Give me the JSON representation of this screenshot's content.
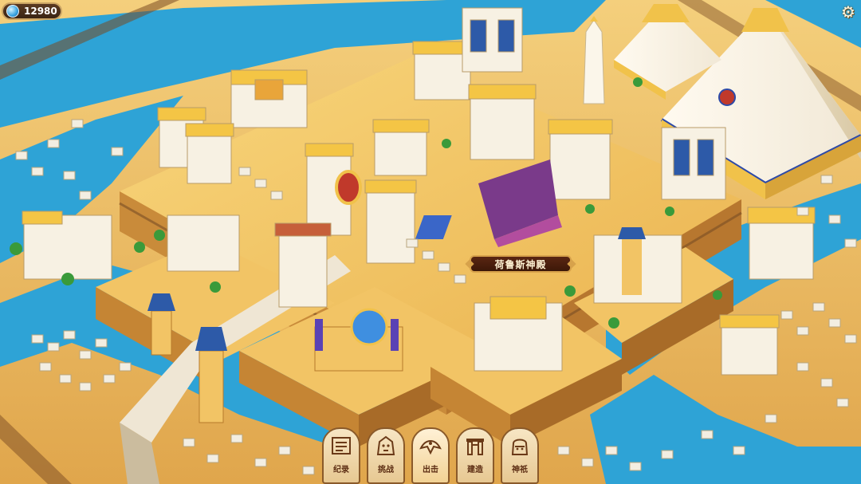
{
  "hud": {
    "gold_amount": "12980",
    "gem_icon": "blue-gem-icon",
    "settings_icon": "gear-icon"
  },
  "map": {
    "temple_label": "荷鲁斯神殿"
  },
  "bottom_menu": {
    "items": [
      {
        "label": "纪录",
        "icon": "scroll-icon"
      },
      {
        "label": "挑战",
        "icon": "sphinx-head-icon"
      },
      {
        "label": "出击",
        "icon": "horus-falcon-icon"
      },
      {
        "label": "建造",
        "icon": "temple-gate-icon"
      },
      {
        "label": "神祇",
        "icon": "pharaoh-mask-icon"
      }
    ]
  },
  "colors": {
    "sand": "#e8b35a",
    "water": "#2ea3d6",
    "stone": "#f3eee2",
    "gold": "#f1c24a"
  }
}
